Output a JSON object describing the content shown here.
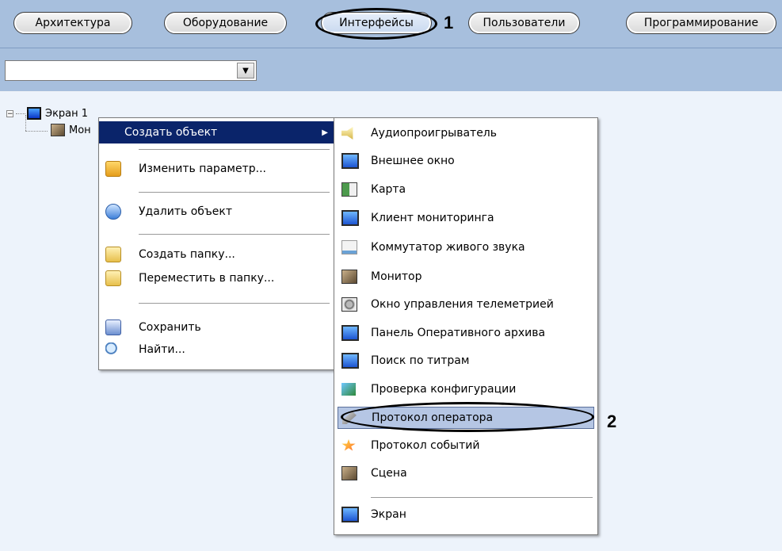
{
  "tabs": [
    {
      "label": "Архитектура"
    },
    {
      "label": "Оборудование"
    },
    {
      "label": "Интерфейсы"
    },
    {
      "label": "Пользователи"
    },
    {
      "label": "Программирование"
    }
  ],
  "callouts": {
    "one": "1",
    "two": "2"
  },
  "combo": {
    "value": ""
  },
  "tree": {
    "root": "Экран 1",
    "child": "Мон"
  },
  "context_menu": {
    "create_object": "Создать объект",
    "edit_param": "Изменить параметр...",
    "delete_object": "Удалить объект",
    "create_folder": "Создать папку...",
    "move_to_folder": "Переместить в папку...",
    "save": "Сохранить",
    "find": "Найти..."
  },
  "submenu": [
    {
      "label": "Аудиопроигрыватель",
      "icon": "speaker-icon"
    },
    {
      "label": "Внешнее окно",
      "icon": "monitor-icon"
    },
    {
      "label": "Карта",
      "icon": "map-icon"
    },
    {
      "label": "Клиент мониторинга",
      "icon": "monitor-icon"
    },
    {
      "label": "Коммутатор живого звука",
      "icon": "window-icon"
    },
    {
      "label": "Монитор",
      "icon": "photo-icon"
    },
    {
      "label": "Окно управления телеметрией",
      "icon": "ptz-icon"
    },
    {
      "label": "Панель Оперативного архива",
      "icon": "monitor-icon"
    },
    {
      "label": "Поиск по титрам",
      "icon": "monitor-icon"
    },
    {
      "label": "Проверка конфигурации",
      "icon": "check-icon"
    },
    {
      "label": "Протокол оператора",
      "icon": "pen-icon"
    },
    {
      "label": "Протокол событий",
      "icon": "star-icon"
    },
    {
      "label": "Сцена",
      "icon": "photo-icon"
    },
    {
      "label": "Экран",
      "icon": "monitor-icon"
    }
  ],
  "colors": {
    "menu_highlight": "#0a246a",
    "toolbar": "#a7bfdd",
    "selected_item": "#b5c6e4"
  }
}
